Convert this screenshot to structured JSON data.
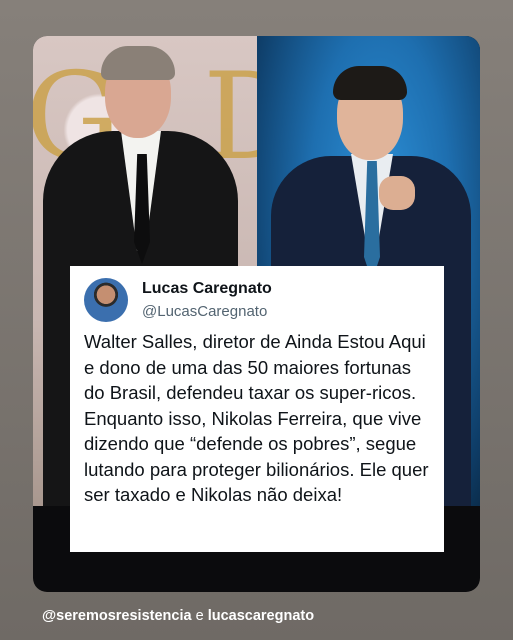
{
  "tweet": {
    "name": "Lucas Caregnato",
    "handle": "@LucasCaregnato",
    "text": "Walter Salles, diretor de Ainda Estou Aqui e dono de uma das 50 maiores fortunas do Brasil, defendeu taxar os super-ricos. Enquanto isso, Nikolas Ferreira, que vive dizendo que “defende os pobres”, segue lutando para proteger bilionários. Ele quer ser taxado e Nikolas não deixa!"
  },
  "footer": {
    "account1": "@seremosresistencia",
    "connector": "e",
    "account2": "lucascaregnato"
  }
}
